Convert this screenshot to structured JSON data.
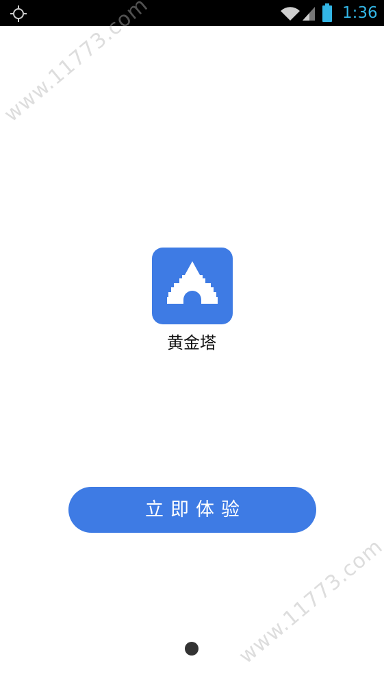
{
  "status_bar": {
    "time": "1:36",
    "icons": [
      "gps-icon",
      "wifi-icon",
      "signal-icon",
      "battery-icon"
    ],
    "clock_color": "#33b5e5"
  },
  "app": {
    "name": "黄金塔",
    "icon": "tower-icon",
    "accent_color": "#3e7be4"
  },
  "start_button": {
    "label": "立即体验"
  },
  "pager": {
    "current_page": 1,
    "total_pages": 1
  },
  "watermarks": [
    "www.11773.com",
    "www.11773.com"
  ]
}
